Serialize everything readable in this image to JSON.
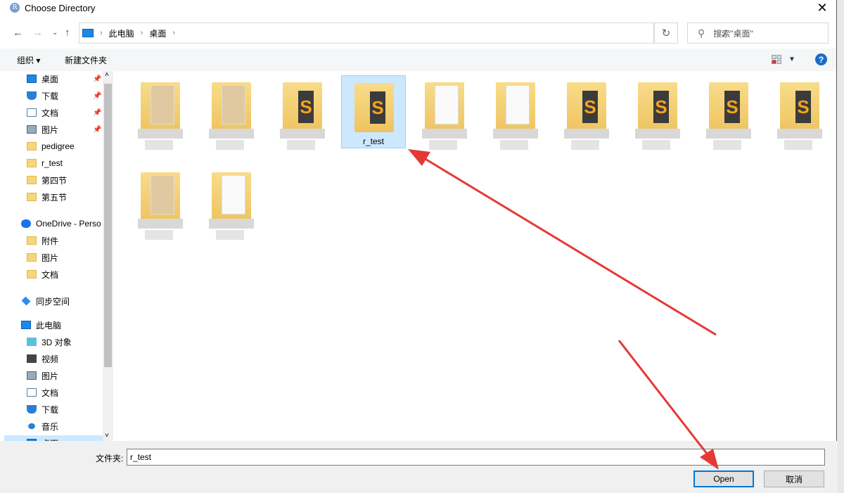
{
  "window": {
    "title": "Choose Directory",
    "app_icon": "R",
    "close": "✕"
  },
  "nav": {
    "breadcrumb": [
      "此电脑",
      "桌面"
    ],
    "search_placeholder": "搜索\"桌面\""
  },
  "toolbar": {
    "organize": "组织 ▾",
    "new_folder": "新建文件夹",
    "help": "?"
  },
  "sidebar": {
    "items": [
      {
        "label": "桌面",
        "icon": "desktop-icon",
        "pinned": true
      },
      {
        "label": "下载",
        "icon": "download-icon",
        "pinned": true
      },
      {
        "label": "文档",
        "icon": "document-icon",
        "pinned": true
      },
      {
        "label": "图片",
        "icon": "picture-icon",
        "pinned": true
      },
      {
        "label": "pedigree",
        "icon": "folder-icon"
      },
      {
        "label": "r_test",
        "icon": "folder-icon"
      },
      {
        "label": "第四节",
        "icon": "folder-icon"
      },
      {
        "label": "第五节",
        "icon": "folder-icon"
      },
      {
        "label": "OneDrive - Perso",
        "icon": "cloud-icon"
      },
      {
        "label": "附件",
        "icon": "folder-icon"
      },
      {
        "label": "图片",
        "icon": "folder-icon"
      },
      {
        "label": "文档",
        "icon": "folder-icon"
      },
      {
        "label": "同步空间",
        "icon": "sync-icon"
      },
      {
        "label": "此电脑",
        "icon": "computer-icon"
      },
      {
        "label": "3D 对象",
        "icon": "3d-icon"
      },
      {
        "label": "视频",
        "icon": "video-icon"
      },
      {
        "label": "图片",
        "icon": "picture-icon"
      },
      {
        "label": "文档",
        "icon": "document-icon"
      },
      {
        "label": "下载",
        "icon": "download-icon"
      },
      {
        "label": "音乐",
        "icon": "music-icon"
      },
      {
        "label": "桌面",
        "icon": "desktop-icon",
        "selected": true
      }
    ]
  },
  "files": [
    {
      "name": "",
      "type": "blurred"
    },
    {
      "name": "",
      "type": "blurred"
    },
    {
      "name": "",
      "type": "sublime"
    },
    {
      "name": "r_test",
      "type": "sublime",
      "selected": true
    },
    {
      "name": "",
      "type": "doc"
    },
    {
      "name": "",
      "type": "doc"
    },
    {
      "name": "",
      "type": "sublime"
    },
    {
      "name": "",
      "type": "sublime"
    },
    {
      "name": "",
      "type": "sublime"
    },
    {
      "name": "",
      "type": "sublime"
    },
    {
      "name": "",
      "type": "blurred"
    },
    {
      "name": "",
      "type": "doc"
    }
  ],
  "footer": {
    "folder_label": "文件夹:",
    "folder_value": "r_test",
    "open": "Open",
    "cancel": "取消"
  },
  "colors": {
    "accent": "#0078d7",
    "selection": "#cce8ff",
    "arrow": "#e53935"
  }
}
